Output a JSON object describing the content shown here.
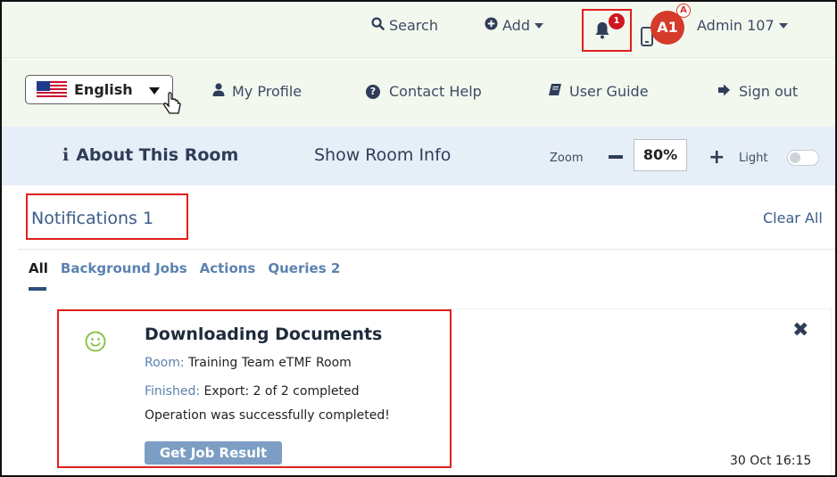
{
  "topbar": {
    "search_label": "Search",
    "add_label": "Add",
    "notification_count": "1",
    "avatar_initials": "A1",
    "avatar_superscript": "A",
    "user_name": "Admin 107"
  },
  "navbar": {
    "language": "English",
    "my_profile": "My Profile",
    "contact_help": "Contact Help",
    "user_guide": "User Guide",
    "sign_out": "Sign out"
  },
  "roombar": {
    "about_room": "About This Room",
    "show_room_info": "Show Room Info",
    "zoom_label": "Zoom",
    "zoom_value": "80%",
    "light_label": "Light",
    "light_enabled": false
  },
  "notifications": {
    "title": "Notifications 1",
    "clear_all": "Clear All",
    "tabs": [
      {
        "label": "All",
        "active": true
      },
      {
        "label": "Background Jobs",
        "active": false
      },
      {
        "label": "Actions",
        "active": false
      },
      {
        "label": "Queries 2",
        "active": false
      }
    ],
    "card": {
      "title": "Downloading Documents",
      "room_key": "Room:",
      "room_value": "Training Team eTMF Room",
      "finished_key": "Finished:",
      "finished_value": "Export: 2 of 2 completed",
      "message": "Operation was successfully completed!",
      "button": "Get Job Result",
      "timestamp": "30 Oct 16:15"
    }
  },
  "colors": {
    "accent_red": "#e0201c",
    "badge_red": "#d0151f",
    "link_blue": "#3a5c88",
    "button_blue": "#7c9ec4",
    "smiley_green": "#8bc34a"
  }
}
